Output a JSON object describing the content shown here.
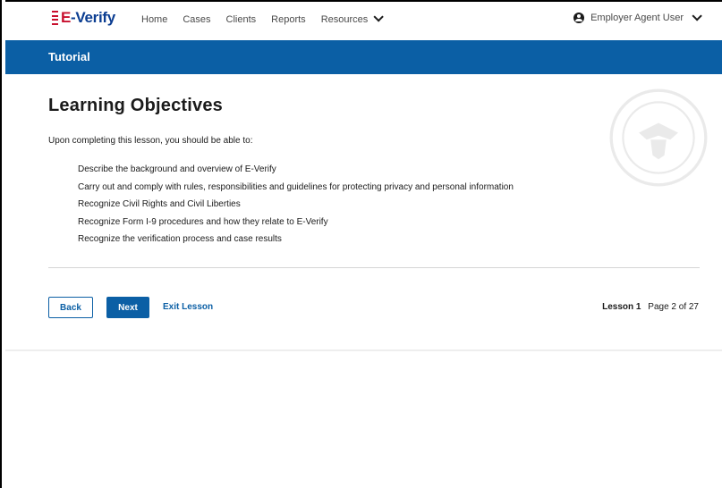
{
  "header": {
    "logo": {
      "prefix": "E",
      "suffix": "-Verify"
    },
    "nav": [
      {
        "label": "Home"
      },
      {
        "label": "Cases"
      },
      {
        "label": "Clients"
      },
      {
        "label": "Reports"
      },
      {
        "label": "Resources"
      }
    ],
    "user_label": "Employer Agent User"
  },
  "banner": {
    "title": "Tutorial"
  },
  "main": {
    "heading": "Learning Objectives",
    "intro": "Upon completing this lesson, you should be able to:",
    "objectives": [
      "Describe the background and overview of E-Verify",
      "Carry out and comply with rules, responsibilities and guidelines for protecting privacy and personal information",
      "Recognize Civil Rights and Civil Liberties",
      "Recognize Form I-9 procedures and how they relate to E-Verify",
      "Recognize the verification process and case results"
    ]
  },
  "footer_nav": {
    "back_label": "Back",
    "next_label": "Next",
    "exit_label": "Exit Lesson",
    "lesson_label": "Lesson 1",
    "page_label": "Page 2 of 27"
  },
  "colors": {
    "brand_blue": "#0b5fa5",
    "logo_red": "#c8102e",
    "logo_navy": "#0b3d91"
  }
}
